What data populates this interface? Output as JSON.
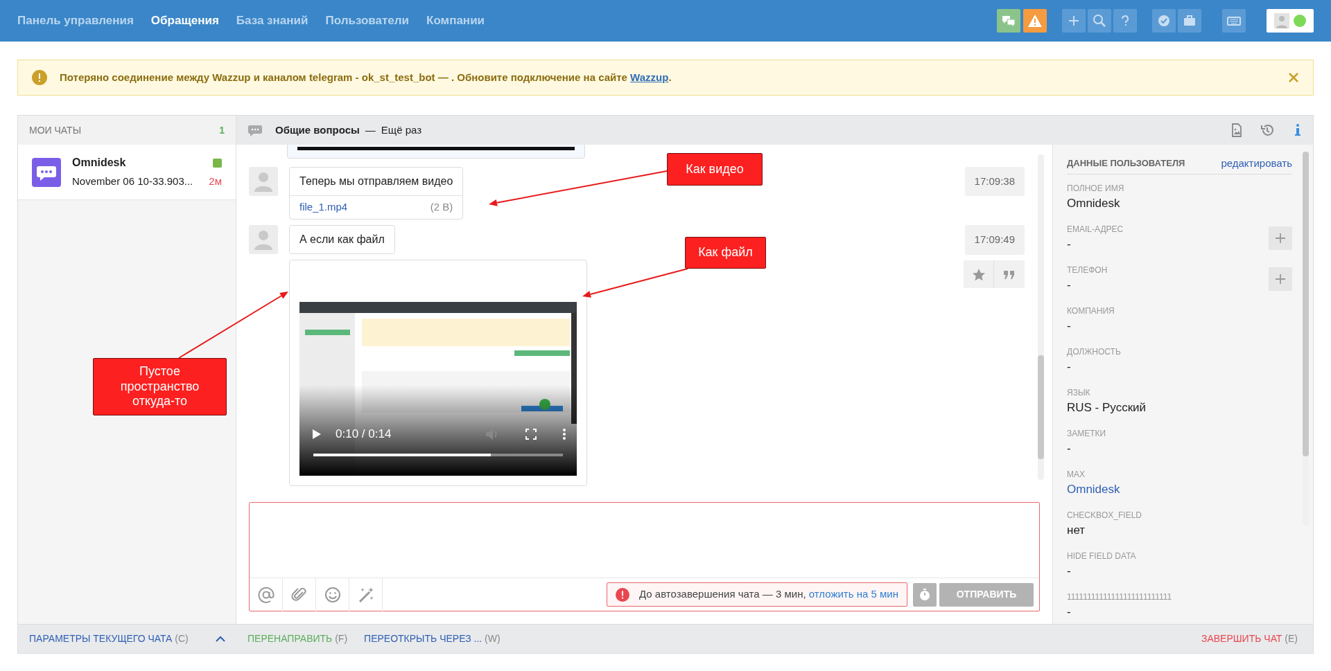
{
  "nav": {
    "items": [
      {
        "label": "Панель управления",
        "selected": false
      },
      {
        "label": "Обращения",
        "selected": true
      },
      {
        "label": "База знаний",
        "selected": false
      },
      {
        "label": "Пользователи",
        "selected": false
      },
      {
        "label": "Компании",
        "selected": false
      }
    ],
    "online": true
  },
  "alert": {
    "text": "Потеряно соединение между Wazzup и каналом telegram - ok_st_test_bot — . Обновите подключение на сайте ",
    "link": "Wazzup",
    "end": "."
  },
  "chats": {
    "title": "МОИ ЧАТЫ",
    "count": "1",
    "items": [
      {
        "name": "Omnidesk",
        "preview": "November 06 10-33.903...",
        "time": "2м"
      }
    ]
  },
  "chat": {
    "title": "Общие вопросы",
    "separator": "—",
    "subtitle": "Ещё раз",
    "messages": [
      {
        "text": "Теперь мы отправляем видео",
        "time": "17:09:38",
        "actions": false,
        "attachment": {
          "kind": "file",
          "name": "file_1.mp4",
          "size": "(2 В)"
        }
      },
      {
        "text": "А если как файл",
        "time": "17:09:49",
        "actions": true,
        "attachment": {
          "kind": "video",
          "time_label": "0:10 / 0:14",
          "level": 0.71
        }
      }
    ]
  },
  "composer": {
    "timer_text": "До автозавершения чата — 3 мин, ",
    "timer_link": "отложить на 5 мин",
    "send": "ОТПРАВИТЬ",
    "send_disabled": true
  },
  "user": {
    "title": "ДАННЫЕ ПОЛЬЗОВАТЕЛЯ",
    "edit": "редактировать",
    "fields": [
      {
        "label": "ПОЛНОЕ ИМЯ",
        "value": "Omnidesk",
        "kind": "text",
        "addable": false
      },
      {
        "label": "EMAIL-АДРЕС",
        "value": "-",
        "kind": "text",
        "addable": true
      },
      {
        "label": "ТЕЛЕФОН",
        "value": "-",
        "kind": "text",
        "addable": true
      },
      {
        "label": "КОМПАНИЯ",
        "value": "-",
        "kind": "text",
        "addable": false
      },
      {
        "label": "ДОЛЖНОСТЬ",
        "value": "-",
        "kind": "text",
        "addable": false
      },
      {
        "label": "ЯЗЫК",
        "value": "RUS - Русский",
        "kind": "text",
        "addable": false
      },
      {
        "label": "ЗАМЕТКИ",
        "value": "-",
        "kind": "text",
        "addable": false
      },
      {
        "label": "MAX",
        "value": "Omnidesk",
        "kind": "link",
        "addable": false
      },
      {
        "label": "CHECKBOX_FIELD",
        "value": "нет",
        "kind": "text",
        "addable": false
      },
      {
        "label": "HIDE FIELD DATA",
        "value": "-",
        "kind": "text",
        "addable": false
      },
      {
        "label": "11111111111111111111111111",
        "value": "-",
        "kind": "text",
        "addable": false
      }
    ]
  },
  "footer": {
    "params": "ПАРАМЕТРЫ ТЕКУЩЕГО ЧАТА",
    "params_key": "(C)",
    "actions": [
      {
        "label": "ПЕРЕНАПРАВИТЬ",
        "key": "(F)",
        "color": "#5cae5c"
      },
      {
        "label": "ПЕРЕОТКРЫТЬ ЧЕРЕЗ ...",
        "key": "(W)",
        "color": "#2f5fb3"
      },
      {
        "label": "ЗАВЕРШИТЬ ЧАТ",
        "key": "(E)",
        "color": "#e8474f"
      }
    ]
  },
  "annotations": [
    {
      "text": "Как видео"
    },
    {
      "text": "Как файл"
    },
    {
      "text": "Пустое пространство откуда-то"
    }
  ]
}
